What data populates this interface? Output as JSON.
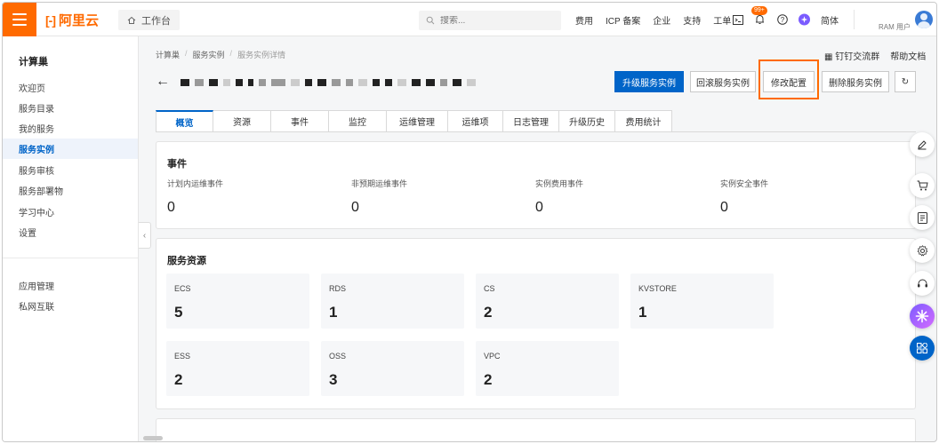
{
  "header": {
    "logo_text": "阿里云",
    "workbench_label": "工作台",
    "search_placeholder": "搜索...",
    "links": [
      "费用",
      "ICP 备案",
      "企业",
      "支持",
      "工单"
    ],
    "notification_count": "99+",
    "language": "简体",
    "user_label": "RAM 用户"
  },
  "sidebar": {
    "title": "计算巢",
    "items": [
      "欢迎页",
      "服务目录",
      "我的服务",
      "服务实例",
      "服务审核",
      "服务部署物",
      "学习中心",
      "设置"
    ],
    "active_index": 3,
    "extra_items": [
      "应用管理",
      "私网互联"
    ]
  },
  "breadcrumb": {
    "items": [
      "计算巢",
      "服务实例",
      "服务实例详情"
    ]
  },
  "doc_links": {
    "dingtalk": "钉钉交流群",
    "help": "帮助文档"
  },
  "actions": {
    "upgrade": "升级服务实例",
    "rollback": "回滚服务实例",
    "modify": "修改配置",
    "delete": "删除服务实例"
  },
  "tabs": [
    "概览",
    "资源",
    "事件",
    "监控",
    "运维管理",
    "运维项",
    "日志管理",
    "升级历史",
    "费用统计"
  ],
  "active_tab": 0,
  "events": {
    "title": "事件",
    "stats": [
      {
        "label": "计划内运维事件",
        "value": "0"
      },
      {
        "label": "非预期运维事件",
        "value": "0"
      },
      {
        "label": "实例费用事件",
        "value": "0"
      },
      {
        "label": "实例安全事件",
        "value": "0"
      }
    ]
  },
  "resources": {
    "title": "服务资源",
    "items": [
      {
        "name": "ECS",
        "count": "5"
      },
      {
        "name": "RDS",
        "count": "1"
      },
      {
        "name": "CS",
        "count": "2"
      },
      {
        "name": "KVSTORE",
        "count": "1"
      },
      {
        "name": "ESS",
        "count": "2"
      },
      {
        "name": "OSS",
        "count": "3"
      },
      {
        "name": "VPC",
        "count": "2"
      }
    ]
  },
  "colors": {
    "brand": "#ff6a00",
    "primary": "#0064c8"
  }
}
